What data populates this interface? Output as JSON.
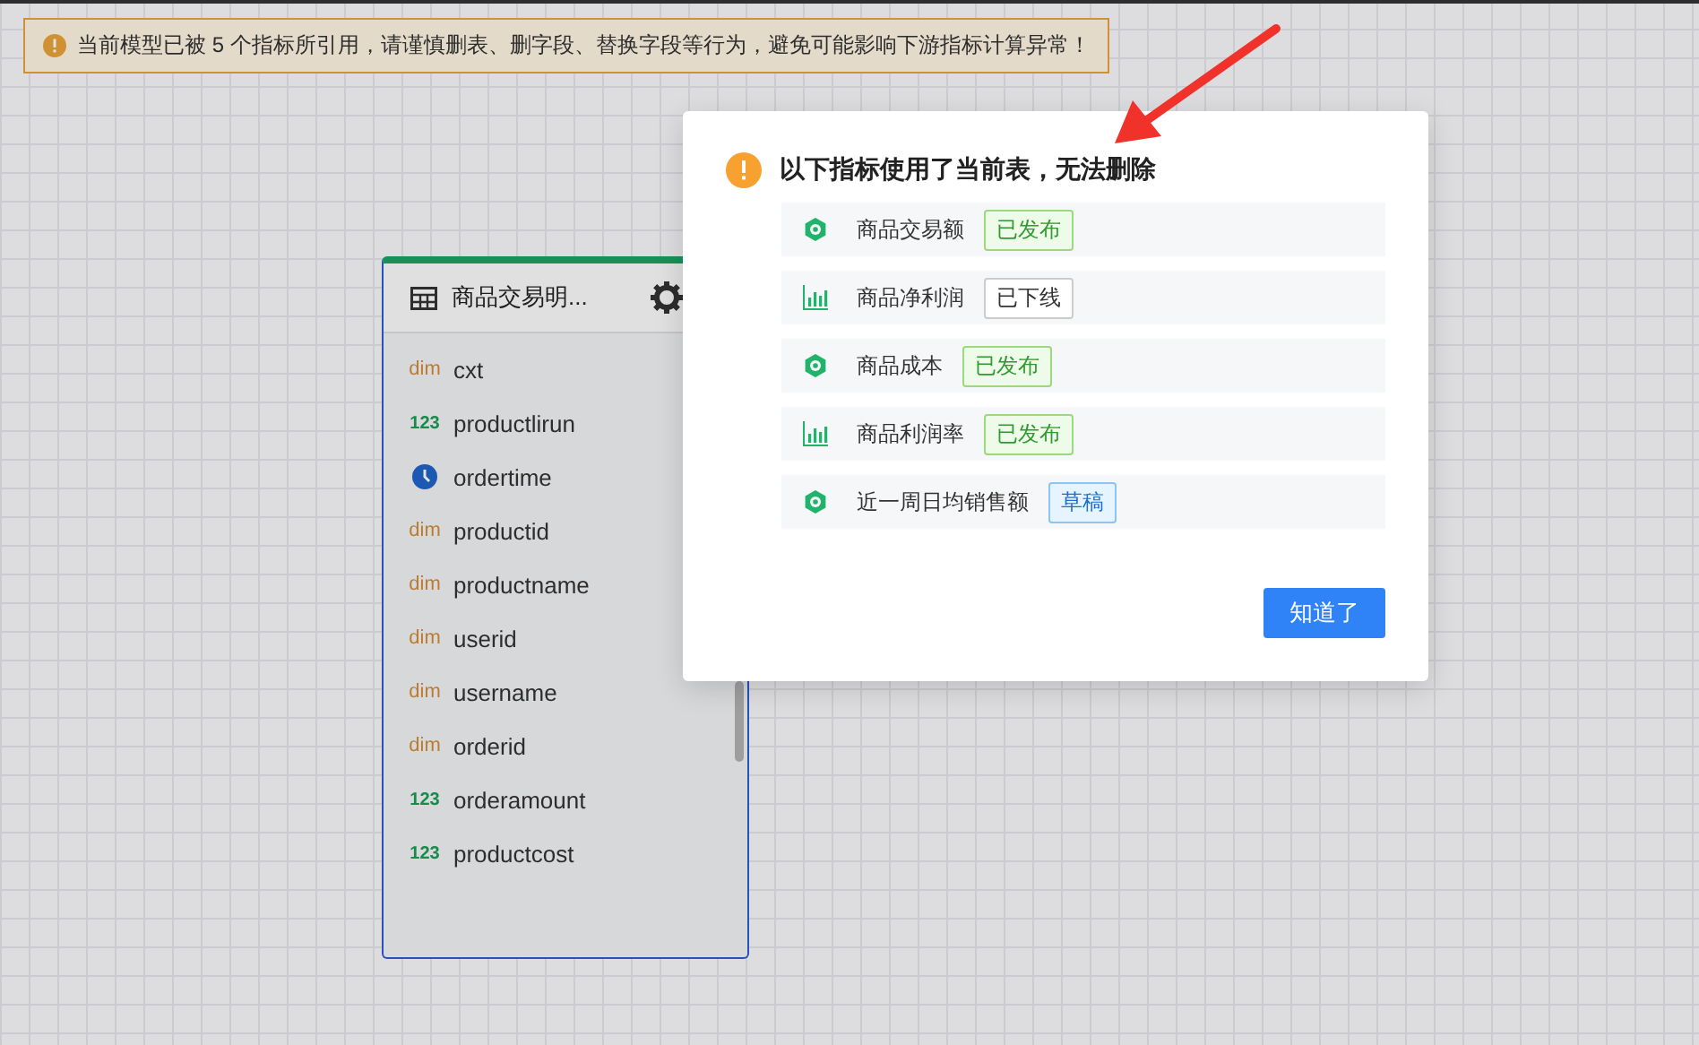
{
  "banner": {
    "text": "当前模型已被 5 个指标所引用，请谨慎删表、删字段、替换字段等行为，避免可能影响下游指标计算异常！"
  },
  "table_card": {
    "title": "商品交易明...",
    "fields": [
      {
        "name": "cxt",
        "kind": "dim",
        "type_label": "dim"
      },
      {
        "name": "productlirun",
        "kind": "number",
        "type_label": "123"
      },
      {
        "name": "ordertime",
        "kind": "time"
      },
      {
        "name": "productid",
        "kind": "dim",
        "type_label": "dim"
      },
      {
        "name": "productname",
        "kind": "dim",
        "type_label": "dim"
      },
      {
        "name": "userid",
        "kind": "dim",
        "type_label": "dim"
      },
      {
        "name": "username",
        "kind": "dim",
        "type_label": "dim"
      },
      {
        "name": "orderid",
        "kind": "dim",
        "type_label": "dim"
      },
      {
        "name": "orderamount",
        "kind": "number",
        "type_label": "123"
      },
      {
        "name": "productcost",
        "kind": "number",
        "type_label": "123"
      }
    ]
  },
  "dialog": {
    "title": "以下指标使用了当前表，无法删除",
    "metrics": [
      {
        "name": "商品交易额",
        "kind": "atomic",
        "tag": {
          "label": "已发布",
          "kind": "published"
        }
      },
      {
        "name": "商品净利润",
        "kind": "derived",
        "tag": {
          "label": "已下线",
          "kind": "offline"
        }
      },
      {
        "name": "商品成本",
        "kind": "atomic",
        "tag": {
          "label": "已发布",
          "kind": "published"
        }
      },
      {
        "name": "商品利润率",
        "kind": "derived",
        "tag": {
          "label": "已发布",
          "kind": "published"
        }
      },
      {
        "name": "近一周日均销售额",
        "kind": "atomic",
        "tag": {
          "label": "草稿",
          "kind": "draft"
        }
      }
    ],
    "button": "知道了"
  }
}
